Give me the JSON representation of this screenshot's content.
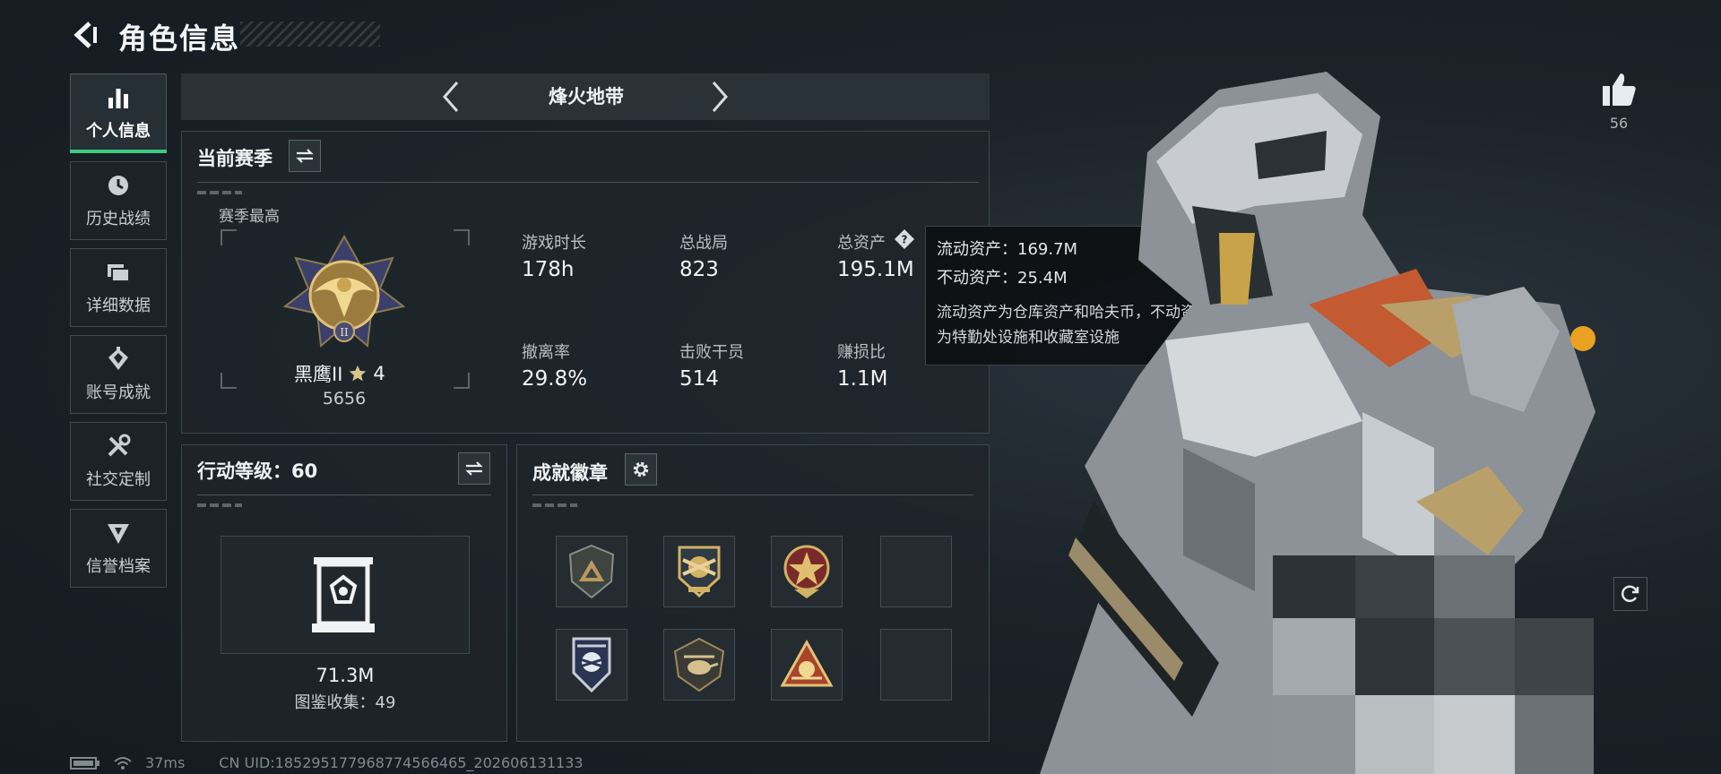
{
  "header": {
    "title": "角色信息"
  },
  "nav": [
    {
      "label": "个人信息",
      "icon": "bar-chart-icon",
      "active": true
    },
    {
      "label": "历史战绩",
      "icon": "clock-icon"
    },
    {
      "label": "详细数据",
      "icon": "folder-icon"
    },
    {
      "label": "账号成就",
      "icon": "achievement-icon"
    },
    {
      "label": "社交定制",
      "icon": "tools-icon"
    },
    {
      "label": "信誉档案",
      "icon": "shield-icon"
    }
  ],
  "mode": {
    "name": "烽火地带"
  },
  "season": {
    "title": "当前赛季",
    "best_label": "赛季最高",
    "rank_name": "黑鹰II",
    "rank_stars": "4",
    "rank_score": "5656",
    "stats": [
      {
        "label": "游戏时长",
        "value": "178h"
      },
      {
        "label": "总战局",
        "value": "823"
      },
      {
        "label": "总资产",
        "value": "195.1M"
      },
      {
        "label": "撤离率",
        "value": "29.8%"
      },
      {
        "label": "击败干员",
        "value": "514"
      },
      {
        "label": "赚损比",
        "value": "1.1M"
      }
    ]
  },
  "tooltip": {
    "liquid": "流动资产：169.7M",
    "fixed": "不动资产：25.4M",
    "desc_line1": "流动资产为仓库资产和哈夫币，不动资产",
    "desc_line2": "为特勤处设施和收藏室设施"
  },
  "level": {
    "title": "行动等级：60",
    "collection_value": "71.3M",
    "collection_label": "图鉴收集：49"
  },
  "badges": {
    "title": "成就徽章",
    "slots": [
      {
        "icon": "triangle-badge-icon",
        "filled": true
      },
      {
        "icon": "propeller-badge-icon",
        "filled": true
      },
      {
        "icon": "star-badge-icon",
        "filled": true
      },
      {
        "icon": "empty-slot",
        "filled": false
      },
      {
        "icon": "wing-badge-icon",
        "filled": true
      },
      {
        "icon": "helicopter-badge-icon",
        "filled": true
      },
      {
        "icon": "sun-badge-icon",
        "filled": true
      },
      {
        "icon": "empty-slot",
        "filled": false
      }
    ]
  },
  "status": {
    "ping": "37ms",
    "uid": "CN UID:185295177968774566465_202606131133"
  },
  "like": {
    "count": "56"
  },
  "colors": {
    "accent": "#3ec97f",
    "panel_bg": "#1e252b",
    "text": "#e6ebee",
    "badge_gold": "#c9a55a"
  }
}
